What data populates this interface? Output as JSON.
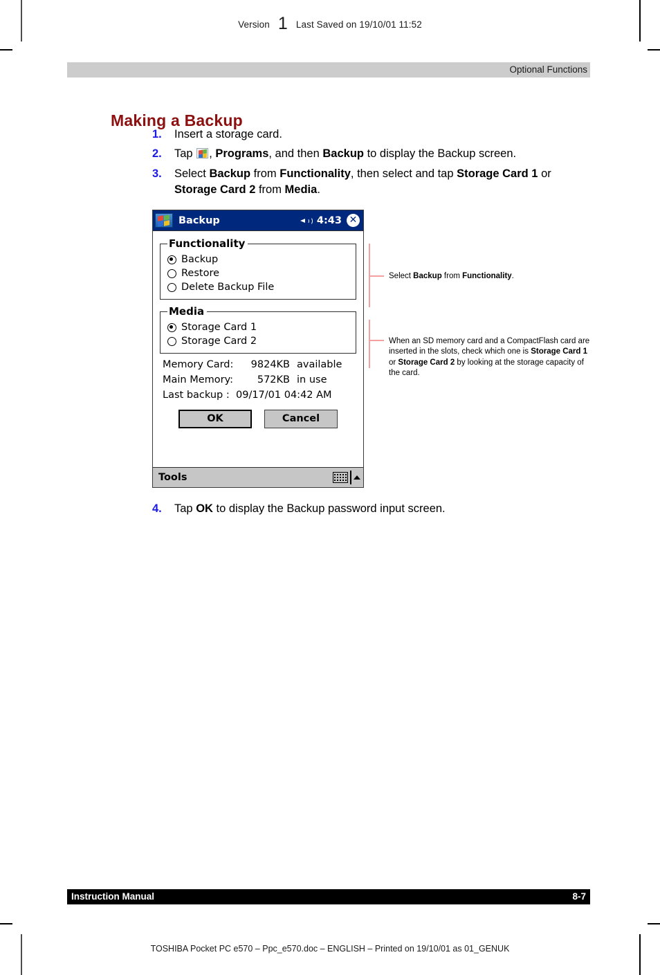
{
  "page": {
    "header": {
      "version_label": "Version",
      "version_number": "1",
      "last_saved": "Last Saved on 19/10/01 11:52"
    },
    "chapter_title": "Optional Functions",
    "section_heading": "Making a Backup",
    "footer": {
      "left": "Instruction Manual",
      "page_number": "8-7",
      "imprint": "TOSHIBA Pocket PC e570  – Ppc_e570.doc – ENGLISH – Printed on 19/10/01 as 01_GENUK"
    }
  },
  "steps": [
    {
      "number": "1.",
      "parts": [
        {
          "t": "Insert a storage card.",
          "b": false
        }
      ]
    },
    {
      "number": "2.",
      "parts": [
        {
          "t": "Tap ",
          "b": false
        },
        {
          "icon": "windows-start-icon"
        },
        {
          "t": ", ",
          "b": false
        },
        {
          "t": "Programs",
          "b": true
        },
        {
          "t": ", and then ",
          "b": false
        },
        {
          "t": "Backup",
          "b": true
        },
        {
          "t": " to display the Backup screen.",
          "b": false
        }
      ]
    },
    {
      "number": "3.",
      "parts": [
        {
          "t": "Select ",
          "b": false
        },
        {
          "t": "Backup",
          "b": true
        },
        {
          "t": " from ",
          "b": false
        },
        {
          "t": "Functionality",
          "b": true
        },
        {
          "t": ", then select and tap ",
          "b": false
        },
        {
          "t": "Storage Card 1",
          "b": true
        },
        {
          "t": " or ",
          "b": false
        },
        {
          "t": "Storage Card 2",
          "b": true
        },
        {
          "t": " from ",
          "b": false
        },
        {
          "t": "Media",
          "b": true
        },
        {
          "t": ".",
          "b": false
        }
      ]
    }
  ],
  "step4": {
    "number": "4.",
    "parts": [
      {
        "t": "Tap ",
        "b": false
      },
      {
        "t": "OK",
        "b": true
      },
      {
        "t": " to display the Backup password input screen.",
        "b": false
      }
    ]
  },
  "pda": {
    "titlebar": {
      "start_icon": "windows-start-icon",
      "title": "Backup",
      "speaker_icon": "speaker-icon",
      "clock": "4:43",
      "close_label": "✕"
    },
    "functionality": {
      "legend": "Functionality",
      "options": [
        {
          "label": "Backup",
          "checked": true
        },
        {
          "label": "Restore",
          "checked": false
        },
        {
          "label": "Delete Backup File",
          "checked": false
        }
      ]
    },
    "media": {
      "legend": "Media",
      "options": [
        {
          "label": "Storage Card 1",
          "checked": true
        },
        {
          "label": "Storage Card 2",
          "checked": false
        }
      ]
    },
    "info": [
      {
        "label": "Memory Card:",
        "value": "9824KB",
        "suffix": "available"
      },
      {
        "label": "Main Memory:",
        "value": "572KB",
        "suffix": "in use"
      },
      {
        "label": "Last backup :",
        "value": "09/17/01  04:42 AM",
        "suffix": ""
      }
    ],
    "buttons": {
      "ok": "OK",
      "cancel": "Cancel"
    },
    "taskbar": {
      "tools": "Tools",
      "keyboard_icon": "keyboard-icon",
      "caret_icon": "caret-up-icon"
    }
  },
  "annotations": [
    {
      "parts": [
        {
          "t": "Select ",
          "b": false
        },
        {
          "t": "Backup",
          "b": true
        },
        {
          "t": " from ",
          "b": false
        },
        {
          "t": "Functionality",
          "b": true
        },
        {
          "t": ".",
          "b": false
        }
      ]
    },
    {
      "parts": [
        {
          "t": "When an SD memory card and a CompactFlash card are inserted in the slots, check which one is ",
          "b": false
        },
        {
          "t": "Storage Card 1",
          "b": true
        },
        {
          "t": " or ",
          "b": false
        },
        {
          "t": "Storage Card 2",
          "b": true
        },
        {
          "t": " by looking at the storage capacity of the card.",
          "b": false
        }
      ]
    }
  ],
  "colors": {
    "heading": "#8c1010",
    "step_number": "#1a1ae6",
    "band": "#cccccc",
    "footer_band": "#000000",
    "annotation_line": "#f4a0a0",
    "pda_titlebar": "#00287d"
  }
}
